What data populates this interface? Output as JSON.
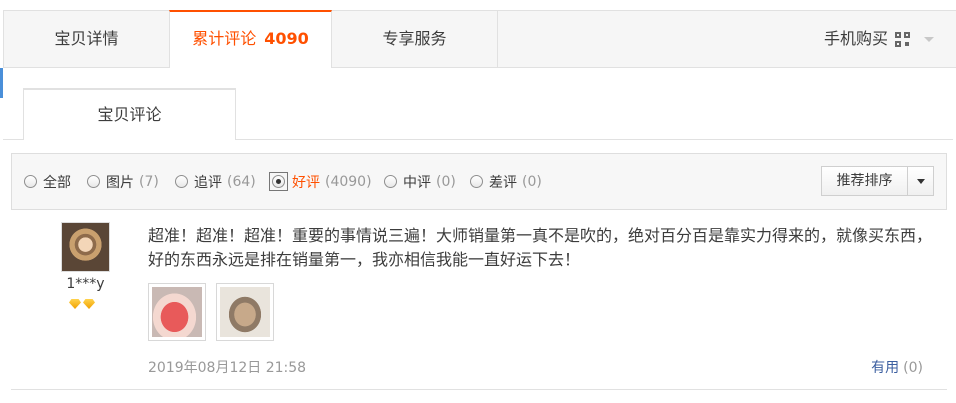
{
  "tabs": {
    "details": "宝贝详情",
    "reviews": "累计评论",
    "reviews_count": "4090",
    "service": "专享服务",
    "mobile_buy": "手机购买"
  },
  "subtab": "宝贝评论",
  "filters": [
    {
      "label": "全部",
      "count": ""
    },
    {
      "label": "图片",
      "count": "(7)"
    },
    {
      "label": "追评",
      "count": "(64)"
    },
    {
      "label": "好评",
      "count": "(4090)"
    },
    {
      "label": "中评",
      "count": "(0)"
    },
    {
      "label": "差评",
      "count": "(0)"
    }
  ],
  "sort_label": "推荐排序",
  "review": {
    "user": "1***y",
    "text": "超准！超准！超准！重要的事情说三遍！大师销量第一真不是吹的，绝对百分百是靠实力得来的，就像买东西，好的东西永远是排在销量第一，我亦相信我能一直好运下去！",
    "date": "2019年08月12日 21:58",
    "useful_label": "有用",
    "useful_count": "(0)"
  },
  "colors": {
    "accent": "#ff5000",
    "link": "#3c5fa0"
  }
}
